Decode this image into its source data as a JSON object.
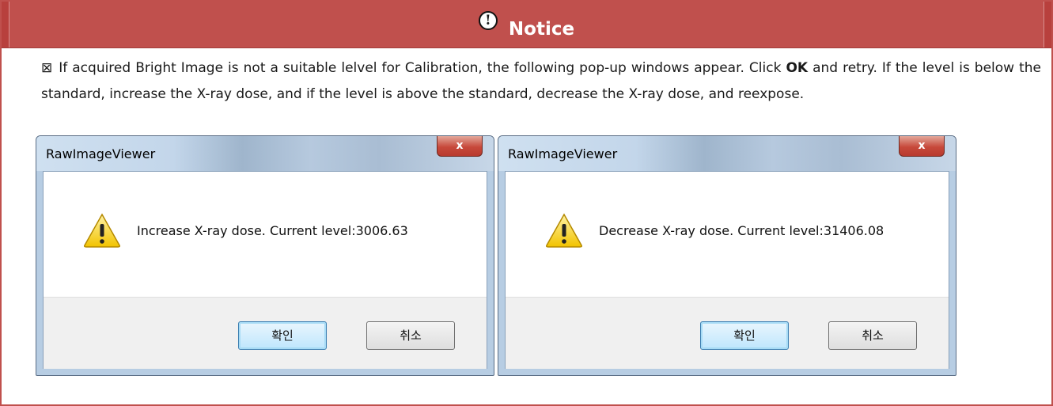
{
  "notice": {
    "icon": "alert-circle-icon",
    "title": "Notice",
    "bullet": "⊠",
    "paragraph_part1": "If acquired Bright Image is not a suitable lelvel for Calibration, the following pop-up windows appear. Click ",
    "paragraph_bold": "OK",
    "paragraph_part2": " and retry. If the level is below the standard, increase the X-ray dose, and if the level is above the standard, decrease the X-ray dose, and reexpose."
  },
  "dialogs": [
    {
      "title": "RawImageViewer",
      "close_label": "x",
      "icon": "warning-icon",
      "message": "Increase X-ray dose. Current level:3006.63",
      "ok_label": "확인",
      "cancel_label": "취소"
    },
    {
      "title": "RawImageViewer",
      "close_label": "x",
      "icon": "warning-icon",
      "message": "Decrease X-ray dose. Current level:31406.08",
      "ok_label": "확인",
      "cancel_label": "취소"
    }
  ],
  "colors": {
    "header_background": "#c0504d",
    "header_text": "#ffffff"
  }
}
